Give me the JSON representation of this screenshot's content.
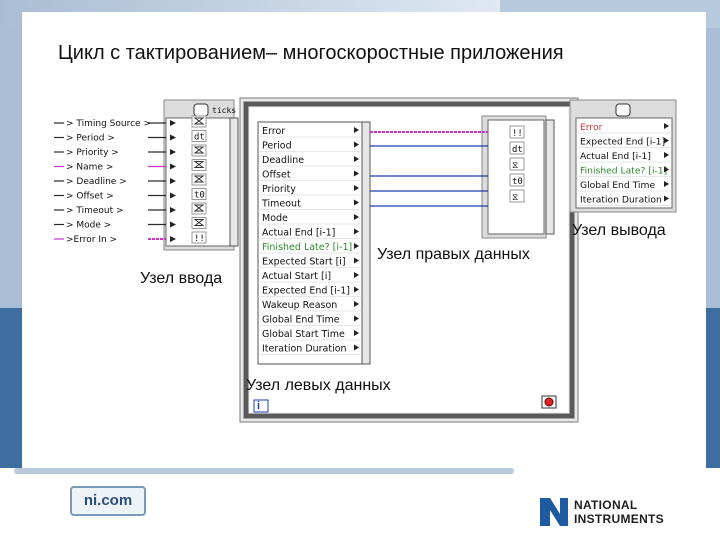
{
  "slide": {
    "title": "Цикл с тактированием– многоскоростные приложения"
  },
  "left_node": {
    "terminals": [
      "Timing Source",
      "Period",
      "Priority",
      "Name",
      "Deadline",
      "Offset",
      "Timeout",
      "Mode",
      "Error In"
    ],
    "header_label": "ticks",
    "icons": [
      "ms",
      "dt",
      "id",
      "name",
      "hourglass",
      "t0",
      "hourglass-x",
      "mode",
      "error"
    ],
    "inner_labels": [
      "dt",
      "t0"
    ]
  },
  "right_data_node": {
    "items": [
      "Error",
      "Period",
      "Deadline",
      "Offset",
      "Priority",
      "Timeout",
      "Mode",
      "Actual End [i-1]",
      "Finished Late? [i-1]",
      "Expected Start [i]",
      "Actual Start [i]",
      "Expected End [i-1]",
      "Wakeup Reason",
      "Global End Time",
      "Global Start Time",
      "Iteration Duration"
    ]
  },
  "left_data_node": {
    "labels": [
      "dt",
      "t0"
    ]
  },
  "output_node": {
    "items": [
      "Error",
      "Expected End [i-1]",
      "Actual End [i-1]",
      "Finished Late? [i-1]",
      "Global End Time",
      "Iteration Duration"
    ]
  },
  "annotations": {
    "input_node": "Узел ввода",
    "right_data_node": "Узел правых данных",
    "output_node": "Узел вывода",
    "left_data_node": "Узел левых данных"
  },
  "loop": {
    "iteration_label": "i"
  },
  "footer": {
    "site": "ni.com",
    "logo_line1": "NATIONAL",
    "logo_line2": "INSTRUMENTS"
  },
  "colors": {
    "accent_blue": "#3e6e9f",
    "light_blue": "#a9bdd4",
    "wire_pink": "#cc33cc",
    "wire_blue": "#1a3fb0",
    "finished_late_green": "#2f8a2f"
  }
}
